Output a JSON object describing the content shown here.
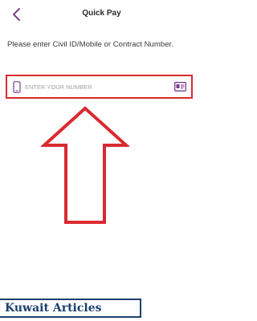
{
  "header": {
    "title": "Quick Pay",
    "back_icon": "chevron-left-icon"
  },
  "prompt_text": "Please enter Civil ID/Mobile or Contract Number.",
  "number_field": {
    "placeholder": "ENTER YOUR NUMBER",
    "value": "",
    "leading_icon": "phone-icon",
    "trailing_icon": "id-card-icon"
  },
  "annotation": {
    "arrow_icon": "up-arrow-icon",
    "highlight_color": "#d92a30"
  },
  "watermark": {
    "word1": "Kuwait",
    "word2": "Articles"
  },
  "colors": {
    "accent": "#7a3e8e",
    "annotation_red": "#d92a30",
    "watermark_blue": "#1b3f6e"
  }
}
